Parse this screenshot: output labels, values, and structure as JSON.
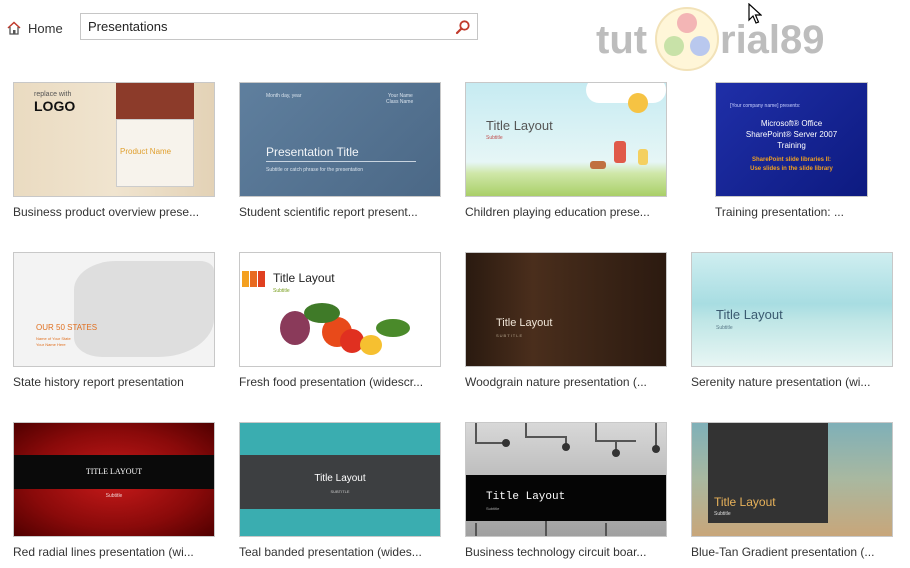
{
  "header": {
    "home_label": "Home",
    "search_value": "Presentations",
    "watermark": {
      "part1": "tut",
      "part2": "rial89"
    }
  },
  "templates": [
    {
      "name": "Business product overview prese...",
      "slide": {
        "small": "replace with",
        "logo": "LOGO",
        "product": "Product Name"
      }
    },
    {
      "name": "Student scientific report present...",
      "slide": {
        "date": "Month day, year",
        "name": "Your Name",
        "class": "Class Name",
        "title": "Presentation Title",
        "subtitle": "Subtitle or catch phrase for the presentation"
      }
    },
    {
      "name": "Children playing education prese...",
      "slide": {
        "title": "Title Layout",
        "subtitle": "Subtitle"
      }
    },
    {
      "name": "Training presentation: ...",
      "slide": {
        "company": "[Your company name] presents:",
        "line1": "Microsoft® Office",
        "line2": "SharePoint® Server 2007",
        "line3": "Training",
        "hl1": "SharePoint slide libraries II:",
        "hl2": "Use slides in the slide library"
      }
    },
    {
      "name": "State history report presentation",
      "slide": {
        "title": "OUR 50 STATES",
        "sub1": "Name of Your State",
        "sub2": "Your Name Here"
      }
    },
    {
      "name": "Fresh food presentation (widescr...",
      "slide": {
        "title": "Title Layout",
        "subtitle": "Subtitle"
      }
    },
    {
      "name": "Woodgrain nature presentation (...",
      "slide": {
        "title": "Title Layout",
        "subtitle": "SUBTITLE"
      }
    },
    {
      "name": "Serenity nature presentation (wi...",
      "slide": {
        "title": "Title Layout",
        "subtitle": "Subtitle"
      }
    },
    {
      "name": "Red radial lines presentation (wi...",
      "slide": {
        "title": "TITLE LAYOUT",
        "subtitle": "Subtitle"
      }
    },
    {
      "name": "Teal banded presentation (wides...",
      "slide": {
        "title": "Title Layout",
        "subtitle": "SUBTITLE"
      }
    },
    {
      "name": "Business technology circuit boar...",
      "slide": {
        "title": "Title Layout",
        "subtitle": "Subtitle"
      }
    },
    {
      "name": "Blue-Tan Gradient presentation (...",
      "slide": {
        "title": "Title Layout",
        "subtitle": "Subtitle"
      }
    }
  ],
  "colors": {
    "accent": "#c0392b",
    "watermark_grey": "#bdbdbd",
    "watermark_red": "#e8a0a0"
  }
}
